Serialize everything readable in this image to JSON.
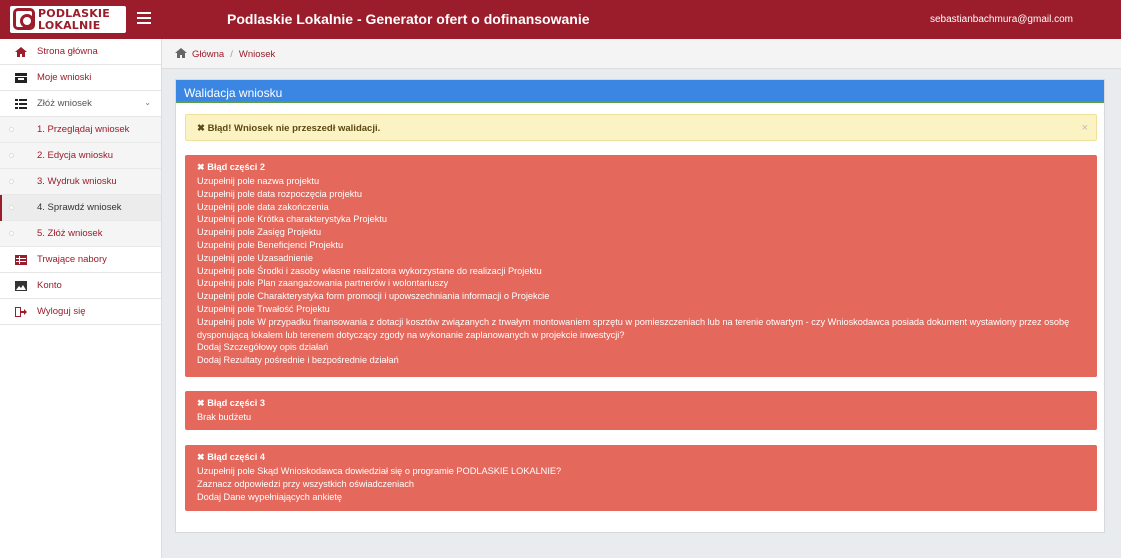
{
  "header": {
    "brand_line1": "PODLASKIE",
    "brand_line2": "LOKALNIE",
    "title": "Podlaskie Lokalnie - Generator ofert o dofinansowanie",
    "user_email": "sebastianbachmura@gmail.com"
  },
  "sidebar": {
    "items": [
      {
        "label": "Strona główna",
        "icon": "home-icon"
      },
      {
        "label": "Moje wnioski",
        "icon": "inbox-icon"
      },
      {
        "label": "Złóż wniosek",
        "icon": "list-icon"
      },
      {
        "label": "Trwające nabory",
        "icon": "table-icon"
      },
      {
        "label": "Konto",
        "icon": "image-icon"
      },
      {
        "label": "Wyloguj się",
        "icon": "logout-icon"
      }
    ],
    "sub_items": [
      {
        "label": "1. Przeglądaj wniosek"
      },
      {
        "label": "2. Edycja wniosku"
      },
      {
        "label": "3. Wydruk wniosku"
      },
      {
        "label": "4. Sprawdź wniosek"
      },
      {
        "label": "5. Złóż wniosek"
      }
    ]
  },
  "breadcrumb": {
    "home": "Główna",
    "current": "Wniosek"
  },
  "panel": {
    "title": "Walidacja wniosku",
    "warning": "Błąd! Wniosek nie przeszedł walidacji.",
    "close": "×"
  },
  "errors": [
    {
      "title": "Błąd części 2",
      "lines": [
        "Uzupełnij pole nazwa projektu",
        "Uzupełnij pole data rozpoczęcia projektu",
        "Uzupełnij pole data zakończenia",
        "Uzupełnij pole Krótka charakterystyka Projektu",
        "Uzupełnij pole Zasięg Projektu",
        "Uzupełnij pole Beneficjenci Projektu",
        "Uzupełnij pole Uzasadnienie",
        "Uzupełnij pole Środki i zasoby własne realizatora wykorzystane do realizacji Projektu",
        "Uzupełnij pole Plan zaangażowania partnerów i wolontariuszy",
        "Uzupełnij pole Charakterystyka form promocji i upowszechniania informacji o Projekcie",
        "Uzupełnij pole Trwałość Projektu",
        "Uzupełnij pole W przypadku finansowania z dotacji kosztów związanych z trwałym montowaniem sprzętu w pomieszczeniach lub na terenie otwartym - czy Wnioskodawca posiada dokument wystawiony przez osobę",
        "dysponującą lokalem lub terenem dotyczący zgody na wykonanie zaplanowanych w projekcie inwestycji?",
        "Dodaj Szczegółowy opis działań",
        "Dodaj Rezultaty pośrednie i bezpośrednie działań"
      ]
    },
    {
      "title": "Błąd części 3",
      "lines": [
        "Brak budżetu"
      ]
    },
    {
      "title": "Błąd części 4",
      "lines": [
        "Uzupełnij pole Skąd Wnioskodawca dowiedział się o programie PODLASKIE LOKALNIE?",
        "Zaznacz odpowiedzi przy wszystkich oświadczeniach",
        "Dodaj Dane wypełniających ankietę"
      ]
    }
  ],
  "colors": {
    "brand": "#9b1c2a",
    "panel_header": "#3b86e2",
    "error_box": "#e5685c",
    "warning_box": "#fcf3c4"
  }
}
